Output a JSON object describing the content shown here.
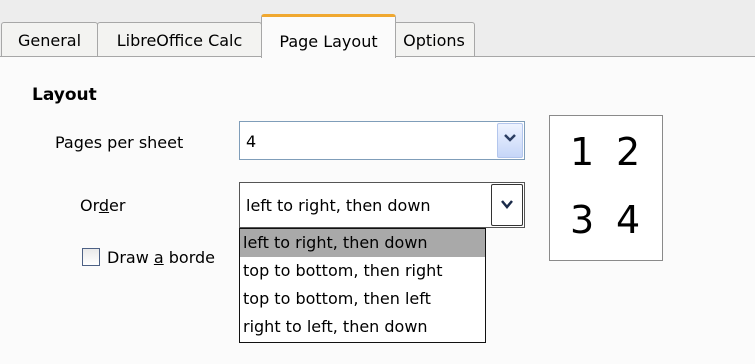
{
  "tabs": [
    {
      "label": "General"
    },
    {
      "label": "LibreOffice Calc"
    },
    {
      "label": "Page Layout"
    },
    {
      "label": "Options"
    }
  ],
  "active_tab": "Page Layout",
  "layout": {
    "section_title": "Layout",
    "pages_per_sheet": {
      "label": "Pages per sheet",
      "value": "4"
    },
    "order": {
      "label_pre": "Or",
      "label_u": "d",
      "label_post": "er",
      "value": "left to right, then down",
      "options": [
        {
          "label": "left to right, then down",
          "selected": true
        },
        {
          "label": "top to bottom, then right",
          "selected": false
        },
        {
          "label": "top to bottom, then left",
          "selected": false
        },
        {
          "label": "right to left, then down",
          "selected": false
        }
      ]
    },
    "draw_border": {
      "label_pre": "Draw ",
      "label_u": "a",
      "label_post": " borde",
      "checked": false
    }
  },
  "preview": {
    "numbers": [
      "1",
      "2",
      "3",
      "4"
    ]
  },
  "colors": {
    "active_tab_accent": "#f0a830",
    "selection_bg": "#a9a9a9"
  }
}
